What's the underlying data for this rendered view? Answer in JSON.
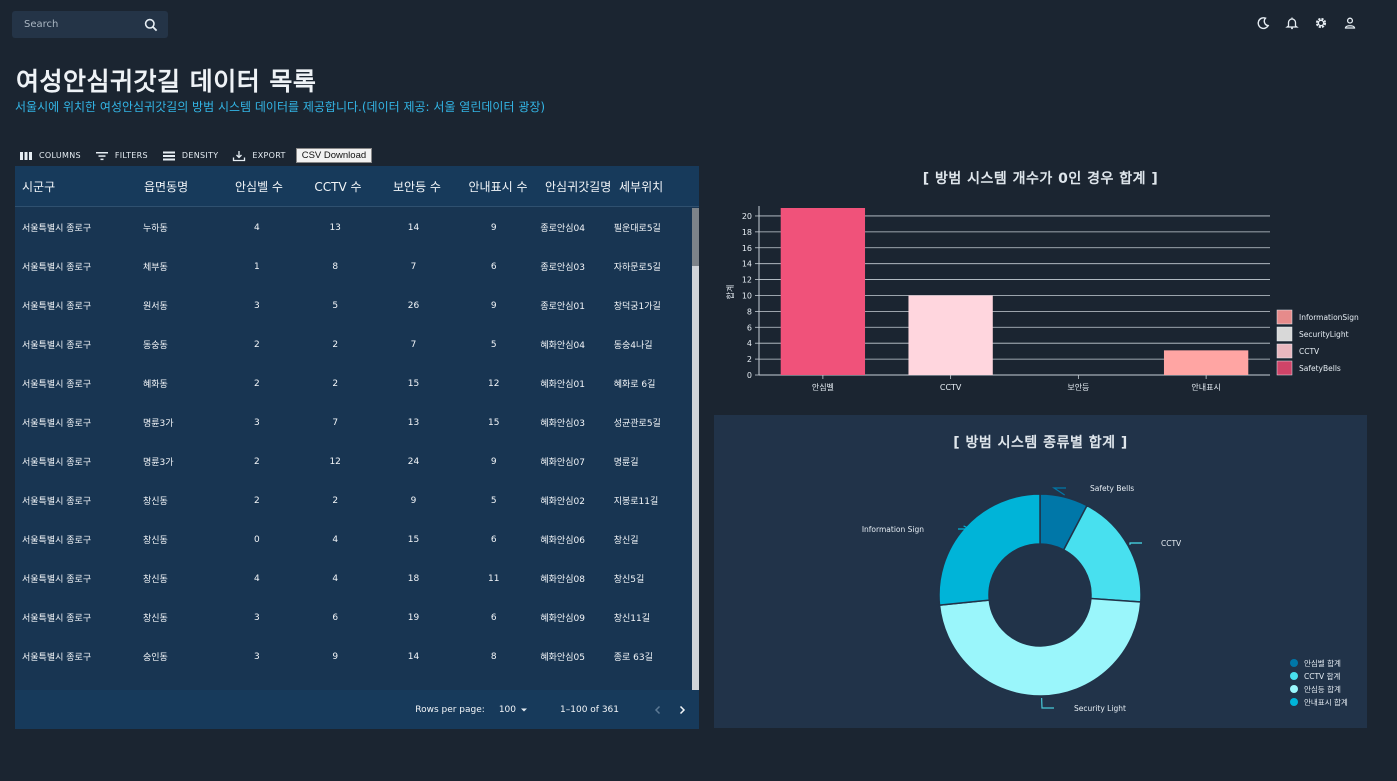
{
  "search": {
    "placeholder": "Search"
  },
  "topbar": {
    "icons": [
      "moon-icon",
      "bell-icon",
      "gear-icon",
      "user-icon"
    ]
  },
  "header": {
    "title": "여성안심귀갓길 데이터 목록",
    "subtitle": "서울시에 위치한 여성안심귀갓길의 방범 시스템 데이터를 제공합니다.(데이터 제공: 서울 열린데이터 광장)"
  },
  "toolbar": {
    "columns": "COLUMNS",
    "filters": "FILTERS",
    "density": "DENSITY",
    "export": "EXPORT",
    "csv": "CSV Download"
  },
  "table": {
    "columns": [
      "시군구",
      "읍면동명",
      "안심벨 수",
      "CCTV 수",
      "보안등 수",
      "안내표시 수",
      "안심귀갓길명",
      "세부위치"
    ],
    "rows": [
      [
        "서울특별시 종로구",
        "누하동",
        "4",
        "13",
        "14",
        "9",
        "종로안심04",
        "필운대로5길"
      ],
      [
        "서울특별시 종로구",
        "체부동",
        "1",
        "8",
        "7",
        "6",
        "종로안심03",
        "자하문로5길"
      ],
      [
        "서울특별시 종로구",
        "원서동",
        "3",
        "5",
        "26",
        "9",
        "종로안심01",
        "창덕궁1가길"
      ],
      [
        "서울특별시 종로구",
        "동숭동",
        "2",
        "2",
        "7",
        "5",
        "혜화안심04",
        "동숭4나길"
      ],
      [
        "서울특별시 종로구",
        "혜화동",
        "2",
        "2",
        "15",
        "12",
        "혜화안심01",
        "혜화로 6길"
      ],
      [
        "서울특별시 종로구",
        "명륜3가",
        "3",
        "7",
        "13",
        "15",
        "혜화안심03",
        "성균관로5길"
      ],
      [
        "서울특별시 종로구",
        "명륜3가",
        "2",
        "12",
        "24",
        "9",
        "혜화안심07",
        "명륜길"
      ],
      [
        "서울특별시 종로구",
        "창신동",
        "2",
        "2",
        "9",
        "5",
        "혜화안심02",
        "지봉로11길"
      ],
      [
        "서울특별시 종로구",
        "창신동",
        "0",
        "4",
        "15",
        "6",
        "혜화안심06",
        "창신길"
      ],
      [
        "서울특별시 종로구",
        "창신동",
        "4",
        "4",
        "18",
        "11",
        "혜화안심08",
        "창신5길"
      ],
      [
        "서울특별시 종로구",
        "창신동",
        "3",
        "6",
        "19",
        "6",
        "혜화안심09",
        "창신11길"
      ],
      [
        "서울특별시 종로구",
        "숭인동",
        "3",
        "9",
        "14",
        "8",
        "혜화안심05",
        "종로 63길"
      ]
    ],
    "footer": {
      "rows_per_page_label": "Rows per page:",
      "rows_per_page": "100",
      "range": "1–100 of 361"
    }
  },
  "chart_data": [
    {
      "type": "bar",
      "title": "[ 방범 시스템 개수가 0인 경우 합계 ]",
      "categories": [
        "안심벨",
        "CCTV",
        "보안등",
        "안내표시"
      ],
      "values": [
        21,
        10,
        0,
        3.1
      ],
      "colors": [
        "#f0527a",
        "#ffd6de",
        "#ffc0cb",
        "#ffa5a3"
      ],
      "ylabel": "합계",
      "ylim": [
        0,
        21
      ],
      "yticks": [
        0,
        2,
        4,
        6,
        8,
        10,
        12,
        14,
        16,
        18,
        20
      ],
      "grid": true,
      "legend": {
        "placement": "right",
        "entries": [
          {
            "name": "InformationSign",
            "color": "#e68b8b"
          },
          {
            "name": "SecurityLight",
            "color": "#d8d8d8"
          },
          {
            "name": "CCTV",
            "color": "#e9b7bf"
          },
          {
            "name": "SafetyBells",
            "color": "#cf4468"
          }
        ]
      }
    },
    {
      "type": "pie",
      "title": "[ 방범 시스템 종류별 합계 ]",
      "donut": true,
      "slices": [
        {
          "label": "Safety Bells",
          "value": 7.7,
          "color": "#0077a8"
        },
        {
          "label": "CCTV",
          "value": 18.4,
          "color": "#48e0ef"
        },
        {
          "label": "Security Light",
          "value": 47.3,
          "color": "#9af6fb"
        },
        {
          "label": "Information Sign",
          "value": 26.6,
          "color": "#00b4d8"
        }
      ],
      "legend": {
        "placement": "bottom-right",
        "entries": [
          {
            "name": "안심벨 합계",
            "color": "#0077a8"
          },
          {
            "name": "CCTV 합계",
            "color": "#48e0ef"
          },
          {
            "name": "안심등 합계",
            "color": "#9af6fb"
          },
          {
            "name": "안내표시 합계",
            "color": "#00b4d8"
          }
        ]
      }
    }
  ]
}
